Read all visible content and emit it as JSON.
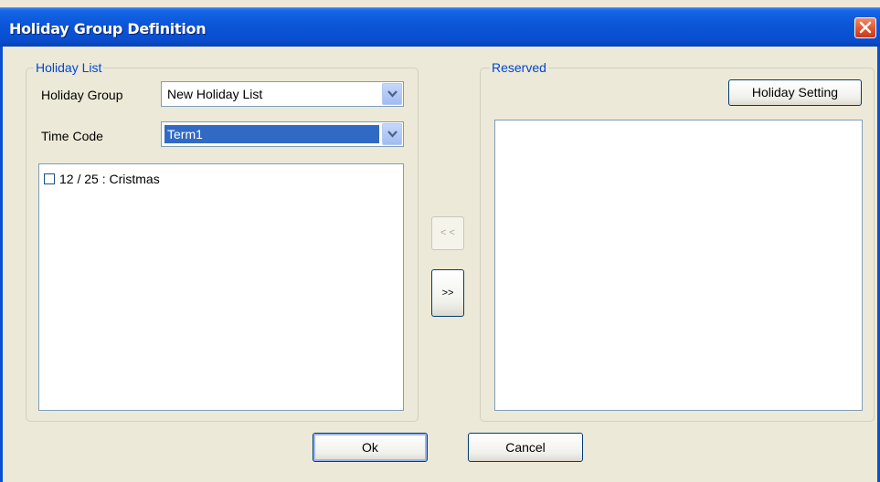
{
  "window": {
    "title": "Holiday Group Definition"
  },
  "holiday_list": {
    "legend": "Holiday List",
    "group_label": "Holiday Group",
    "group_value": "New Holiday List",
    "time_code_label": "Time Code",
    "time_code_value": "Term1",
    "items": [
      {
        "label": "12 / 25 : Cristmas",
        "checked": false
      }
    ]
  },
  "transfer": {
    "move_left_label": "< <",
    "move_right_label": ">>"
  },
  "reserved": {
    "legend": "Reserved",
    "holiday_setting_label": "Holiday Setting"
  },
  "footer": {
    "ok_label": "Ok",
    "cancel_label": "Cancel"
  },
  "colors": {
    "title_bar": "#0a4fd0",
    "legend_text": "#0046d5",
    "selection": "#316ac5",
    "close": "#e2552d"
  }
}
